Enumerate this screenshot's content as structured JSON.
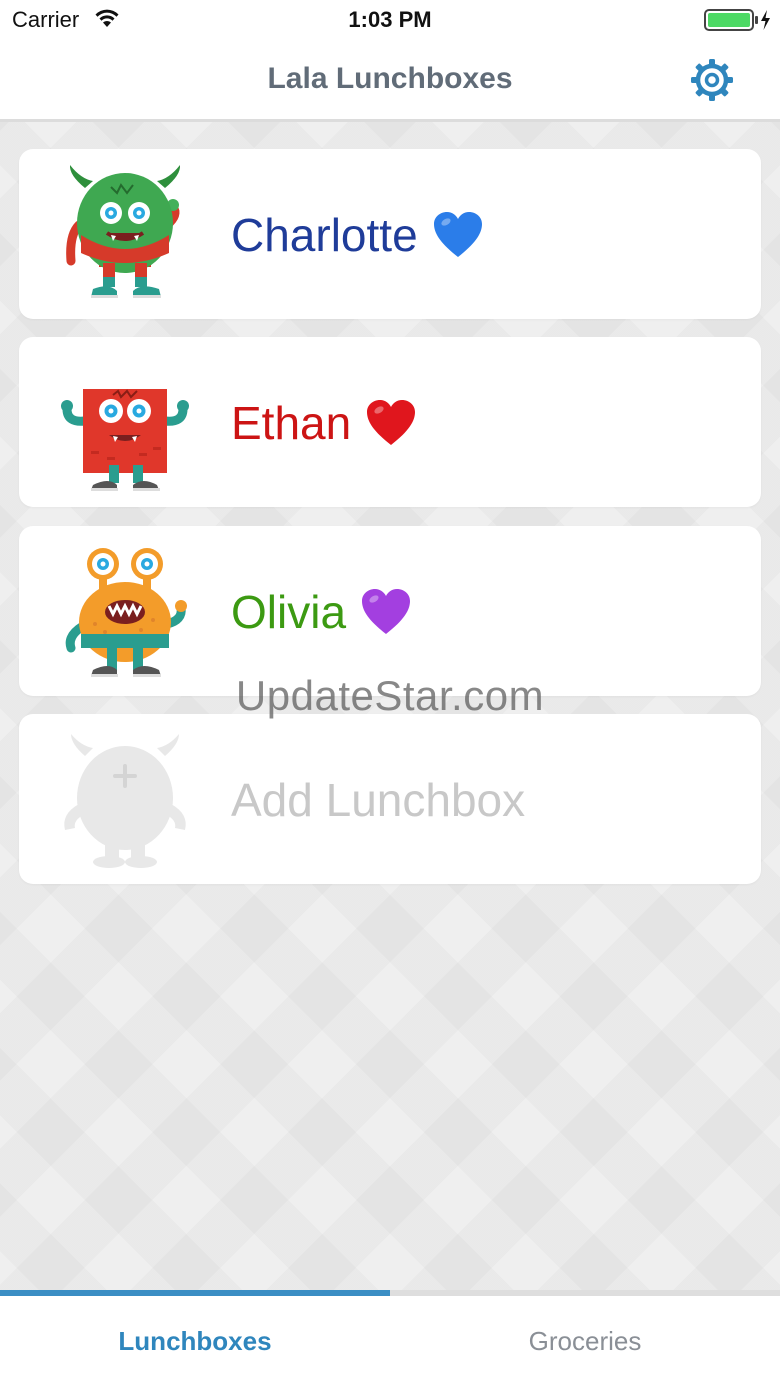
{
  "status_bar": {
    "carrier": "Carrier",
    "time": "1:03 PM",
    "battery_level": 1.0,
    "icons": [
      "wifi-icon",
      "battery-charging-icon"
    ]
  },
  "nav": {
    "title": "Lala Lunchboxes",
    "settings_icon": "gear-icon",
    "accent_color": "#2f86bd"
  },
  "lunchboxes": [
    {
      "name": "Charlotte",
      "color": "#1f3c99",
      "heart": "blue-heart-icon",
      "heart_color": "#2b7de9",
      "avatar": "green-monster-icon"
    },
    {
      "name": "Ethan",
      "color": "#cc1414",
      "heart": "red-heart-icon",
      "heart_color": "#e0161d",
      "avatar": "red-square-monster-icon"
    },
    {
      "name": "Olivia",
      "color": "#3c9a12",
      "heart": "purple-heart-icon",
      "heart_color": "#a33fe0",
      "avatar": "orange-monster-icon"
    }
  ],
  "add_lunchbox": {
    "label": "Add Lunchbox",
    "avatar": "add-monster-icon",
    "color": "#c8c8c8"
  },
  "watermark": "UpdateStar.com",
  "tabs": [
    {
      "label": "Lunchboxes",
      "active": true
    },
    {
      "label": "Groceries",
      "active": false
    }
  ]
}
